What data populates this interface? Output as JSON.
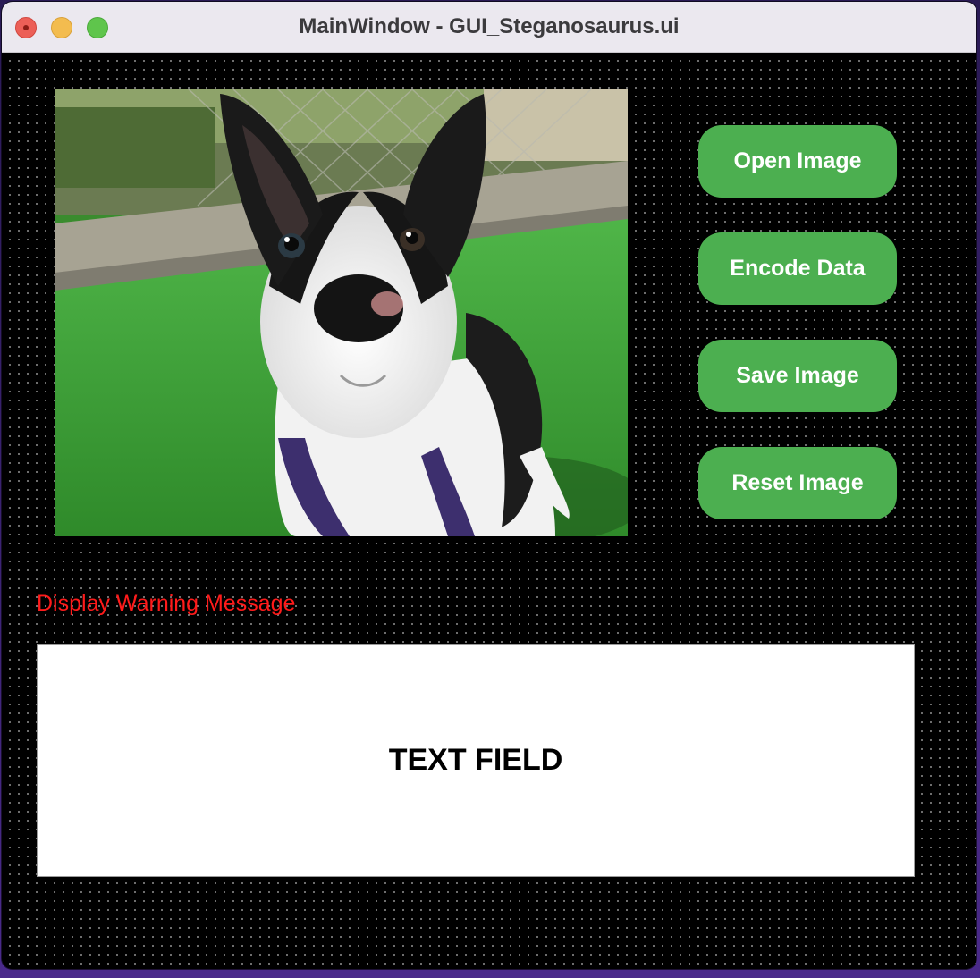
{
  "window": {
    "title": "MainWindow - GUI_Steganosaurus.ui"
  },
  "image": {
    "icon": "dog-photo",
    "description_colors": {
      "grass": "#3a9a35",
      "fur_dark": "#1a1a1a",
      "fur_light": "#f3f3f3",
      "harness": "#3d2f6e"
    }
  },
  "buttons": {
    "open": "Open Image",
    "encode": "Encode Data",
    "save": "Save Image",
    "reset": "Reset Image"
  },
  "warning": {
    "text": "Display Warning Message",
    "color": "#ff1a1a"
  },
  "text_field": {
    "label": "TEXT FIELD"
  },
  "colors": {
    "button_bg": "#4caf50",
    "window_bg": "#000000",
    "titlebar_bg": "#ebe8ef"
  }
}
